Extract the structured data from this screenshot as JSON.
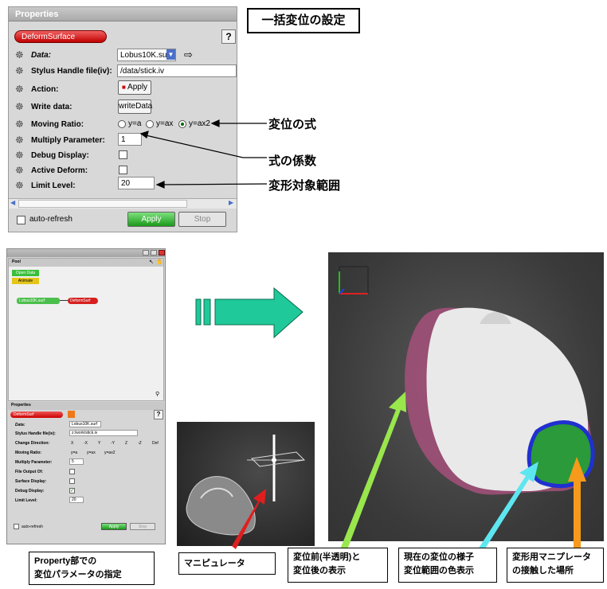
{
  "top_title": "一括変位の設定",
  "props_panel": {
    "title": "Properties",
    "node_name": "DeformSurface",
    "help": "?",
    "rows": [
      {
        "label": "Data:",
        "value": "Lobus10K.surf"
      },
      {
        "label": "Stylus Handle file(iv):",
        "value": "/data/stick.iv"
      },
      {
        "label": "Action:",
        "value": "Apply"
      },
      {
        "label": "Write data:",
        "value": "writeData"
      },
      {
        "label": "Moving Ratio:",
        "options": [
          "y=a",
          "y=ax",
          "y=ax2"
        ],
        "selected": "y=ax2"
      },
      {
        "label": "Multiply Parameter:",
        "value": "1"
      },
      {
        "label": "Debug Display:"
      },
      {
        "label": "Active Deform:"
      },
      {
        "label": "Limit Level:",
        "value": "20"
      }
    ],
    "auto_refresh": "auto-refresh",
    "apply": "Apply",
    "stop": "Stop"
  },
  "callouts": {
    "formula": "変位の式",
    "coef": "式の係数",
    "range": "変形対象範囲"
  },
  "small_window": {
    "pool_title": "Pool",
    "open_data": "Open Data",
    "animate": "Animate",
    "node_a": "Lobus10K.surf",
    "node_b": "DeformSurf",
    "props_title": "Properties",
    "node_name": "DeformSurf",
    "help": "?",
    "rows": [
      {
        "label": "Data:",
        "value": "Lobus10K.surf"
      },
      {
        "label": "Stylus Handle file(iv):",
        "value": "z:/work/stick.iv"
      },
      {
        "label": "Change Direction:",
        "options": [
          "X",
          "-X",
          "Y",
          "-Y",
          "Z",
          "-Z",
          "Def"
        ]
      },
      {
        "label": "Moving Ratio:",
        "options": [
          "y=a",
          "y=ax",
          "y=ax2"
        ]
      },
      {
        "label": "Multiply Parameter:",
        "value": "5"
      },
      {
        "label": "File Output Of:"
      },
      {
        "label": "Surface Display:"
      },
      {
        "label": "Debug Display:"
      },
      {
        "label": "Limit Level:",
        "value": "20"
      }
    ],
    "auto_refresh": "auto-refresh",
    "apply": "Apply",
    "stop": "Stop"
  },
  "captions": {
    "property": [
      "Property部での",
      "変位パラメータの指定"
    ],
    "manipulator": "マニピュレータ",
    "before_after": [
      "変位前(半透明)と",
      "変位後の表示"
    ],
    "current": [
      "現在の変位の様子",
      "変位範囲の色表示"
    ],
    "contact": [
      "変形用マニプレータ",
      "の接触した場所"
    ]
  },
  "colors": {
    "arrow_green": "#99e64d",
    "arrow_cyan": "#5ee6f0",
    "arrow_orange": "#f59a1a",
    "arrow_red": "#e01e1e",
    "big_arrow": "#1fc99a"
  }
}
